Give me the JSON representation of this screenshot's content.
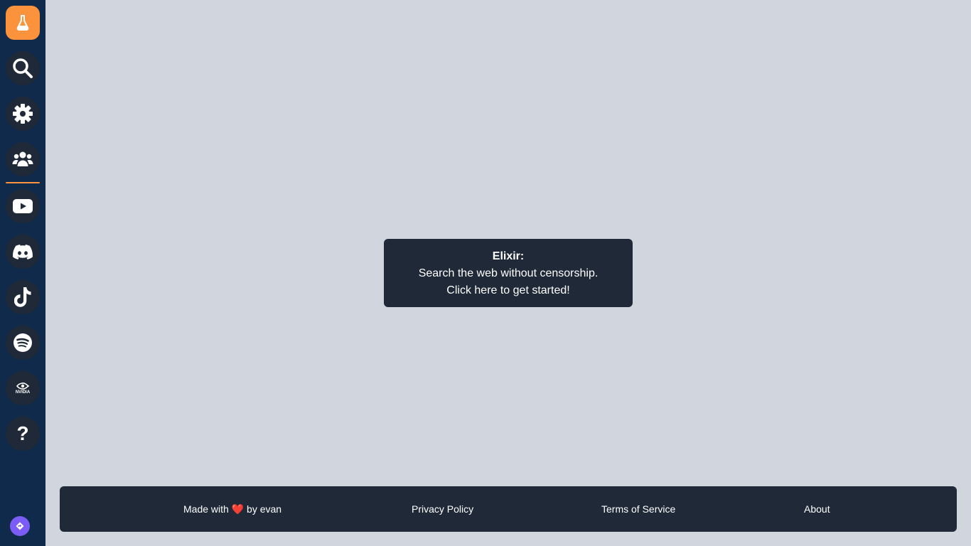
{
  "sidebar": {
    "items": [
      {
        "name": "flask-icon",
        "color": "#fb923c"
      },
      {
        "name": "search-icon"
      },
      {
        "name": "gear-icon"
      },
      {
        "name": "users-icon"
      },
      {
        "name": "youtube-icon"
      },
      {
        "name": "discord-icon"
      },
      {
        "name": "tiktok-icon"
      },
      {
        "name": "spotify-icon"
      },
      {
        "name": "nvidia-icon",
        "label": "NVIDIA"
      },
      {
        "name": "help-icon",
        "label": "?"
      }
    ],
    "accent_color": "#fb923c",
    "mini_button_color": "#7c5cf6",
    "background": "#0f2a4a"
  },
  "card": {
    "title": "Elixir:",
    "line1": "Search the web without censorship.",
    "line2": "Click here to get started!"
  },
  "footer": {
    "made_with_prefix": "Made with",
    "heart": "❤️",
    "made_with_suffix": "by evan",
    "privacy": "Privacy Policy",
    "terms": "Terms of Service",
    "about": "About"
  },
  "colors": {
    "page_background": "#d1d5de",
    "panel": "#1f2937"
  }
}
